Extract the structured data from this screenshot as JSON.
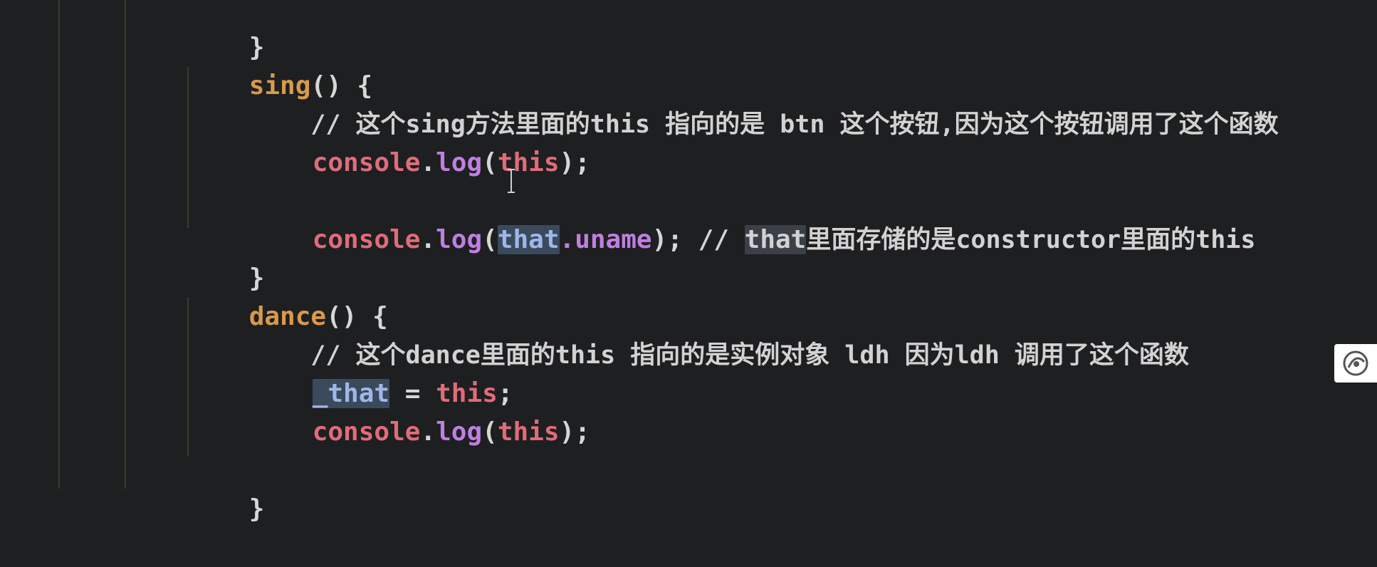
{
  "code": {
    "l0_brace": "}",
    "l1_fn": "sing",
    "l1_rest": "() {",
    "l2_comment": "// 这个sing方法里面的this 指向的是 btn 这个按钮,因为这个按钮调用了这个函数",
    "l3_obj": "console",
    "l3_dot": ".",
    "l3_fn": "log",
    "l3_open": "(",
    "l3_this": "this",
    "l3_close": ");",
    "l5_obj": "console",
    "l5_dot": ".",
    "l5_fn": "log",
    "l5_open": "(",
    "l5_that": "that",
    "l5_prop": ".uname",
    "l5_close": "); ",
    "l5_slashes": "// ",
    "l5_that2": "that",
    "l5_comment_rest": "里面存储的是constructor里面的this",
    "l6_brace": "}",
    "l7_fn": "dance",
    "l7_rest": "() {",
    "l8_comment": "// 这个dance里面的this 指向的是实例对象 ldh 因为ldh 调用了这个函数",
    "l9_var": "_that",
    "l9_eq": " = ",
    "l9_this": "this",
    "l9_semi": ";",
    "l10_obj": "console",
    "l10_dot": ".",
    "l10_fn": "log",
    "l10_open": "(",
    "l10_this": "this",
    "l10_close": ");",
    "l12_brace": "}"
  },
  "icons": {
    "cursor": "i-beam-cursor-icon",
    "side_badge": "recording-badge-icon"
  },
  "colors": {
    "background": "#1e1f21",
    "function_name": "#d89a4a",
    "console": "#e06c7a",
    "log": "#c07fe0",
    "this": "#e06c7a",
    "identifier": "#9fb7e8",
    "comment": "#d2d2d2"
  }
}
